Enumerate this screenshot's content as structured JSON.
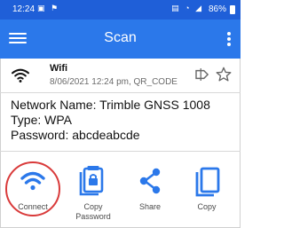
{
  "status_bar": {
    "time": "12:24",
    "battery": "86%"
  },
  "appbar": {
    "title": "Scan",
    "menu_icon": "menu-icon",
    "more_icon": "more-vert-icon"
  },
  "header": {
    "type": "Wifi",
    "meta": "8/06/2021 12:24 pm, QR_CODE",
    "icons": [
      "wifi-icon",
      "tag-icon",
      "star-icon"
    ]
  },
  "content": {
    "network_name": "Network Name: Trimble GNSS 1008",
    "type": "Type: WPA",
    "password": "Password: abcdeabcde"
  },
  "actions": [
    {
      "label": "Connect",
      "icon": "wifi-icon"
    },
    {
      "label": "Copy\nPassword",
      "icon": "copy-password-icon"
    },
    {
      "label": "Share",
      "icon": "share-icon"
    },
    {
      "label": "Copy",
      "icon": "copy-icon"
    }
  ],
  "colors": {
    "status_bar": "#1f5fd8",
    "app_bar": "#2b78ea",
    "accent": "#2b78ea",
    "highlight_circle": "#d93a3a"
  }
}
